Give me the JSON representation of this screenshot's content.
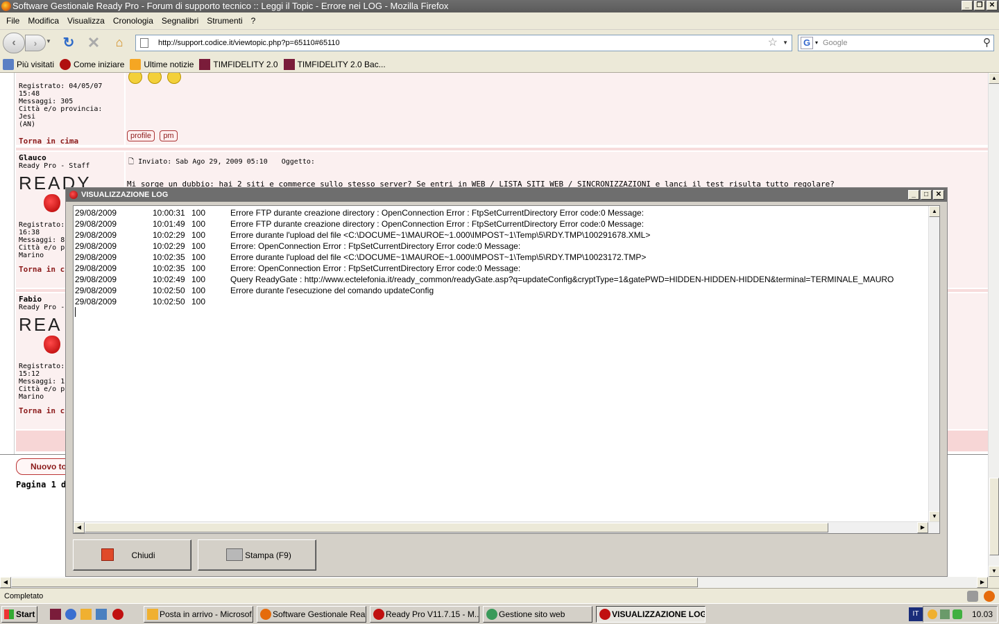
{
  "browser": {
    "title": "Software Gestionale Ready Pro - Forum di supporto tecnico :: Leggi il Topic - Errore nei LOG - Mozilla Firefox",
    "menu": [
      "File",
      "Modifica",
      "Visualizza",
      "Cronologia",
      "Segnalibri",
      "Strumenti",
      "?"
    ],
    "url": "http://support.codice.it/viewtopic.php?p=65110#65110",
    "search_placeholder": "Google",
    "bookmarks": [
      "Più visitati",
      "Come iniziare",
      "Ultime notizie",
      "TIMFIDELITY 2.0",
      "TIMFIDELITY 2.0 Bac..."
    ],
    "status": "Completato"
  },
  "forum": {
    "post1": {
      "registrato": "Registrato: 04/05/07",
      "time": "15:48",
      "messaggi": "Messaggi: 305",
      "citta": "Città e/o provincia: Jesi",
      "citta2": "(AN)",
      "torna": "Torna in cima",
      "btn_profile": "profile",
      "btn_pm": "pm"
    },
    "post2": {
      "name": "Glauco",
      "role": "Ready Pro - Staff",
      "logo": "READY",
      "inviato": "Inviato: Sab Ago 29, 2009 05:10",
      "oggetto": "Oggetto:",
      "body": "Mi sorge un dubbio: hai 2 siti e commerce sullo stesso server? Se entri in WEB / LISTA SITI WEB / SINCRONIZZAZIONI e lanci il test risulta tutto regolare?",
      "registrato": "Registrato: ",
      "time": "16:38",
      "messaggi": "Messaggi: 8",
      "citta": "Città e/o p",
      "citta2": "Marino",
      "torna": "Torna in ci"
    },
    "post3": {
      "name": "Fabio",
      "role": "Ready Pro -",
      "logo": "REA",
      "registrato": "Registrato: ",
      "time": "15:12",
      "messaggi": "Messaggi: 1",
      "citta": "Città e/o p",
      "citta2": "Marino",
      "torna": "Torna in ci"
    },
    "nuovo": "Nuovo to",
    "pagina": "Pagina 1 di"
  },
  "log_window": {
    "title": "VISUALIZZAZIONE LOG",
    "rows": [
      {
        "date": "29/08/2009",
        "time": "10:00:31",
        "code": "100",
        "msg": "Errore FTP durante creazione directory : OpenConnection Error : FtpSetCurrentDirectory Error code:0 Message:"
      },
      {
        "date": "29/08/2009",
        "time": "10:01:49",
        "code": "100",
        "msg": "Errore FTP durante creazione directory : OpenConnection Error : FtpSetCurrentDirectory Error code:0 Message:"
      },
      {
        "date": "29/08/2009",
        "time": "10:02:29",
        "code": "100",
        "msg": "Errore durante l'upload del file <C:\\DOCUME~1\\MAUROE~1.000\\IMPOST~1\\Temp\\5\\RDY.TMP\\100291678.XML>"
      },
      {
        "date": "29/08/2009",
        "time": "10:02:29",
        "code": "100",
        "msg": "Errore: OpenConnection Error : FtpSetCurrentDirectory Error code:0 Message:"
      },
      {
        "date": "29/08/2009",
        "time": "10:02:35",
        "code": "100",
        "msg": "Errore durante l'upload del file <C:\\DOCUME~1\\MAUROE~1.000\\IMPOST~1\\Temp\\5\\RDY.TMP\\10023172.TMP>"
      },
      {
        "date": "29/08/2009",
        "time": "10:02:35",
        "code": "100",
        "msg": "Errore: OpenConnection Error : FtpSetCurrentDirectory Error code:0 Message:"
      },
      {
        "date": "29/08/2009",
        "time": "10:02:49",
        "code": "100",
        "msg": "Query ReadyGate : http://www.ectelefonia.it/ready_common/readyGate.asp?q=updateConfig&cryptType=1&gatePWD=HIDDEN-HIDDEN-HIDDEN&terminal=TERMINALE_MAURO"
      },
      {
        "date": "29/08/2009",
        "time": "10:02:50",
        "code": "100",
        "msg": "Errore durante l'esecuzione del comando updateConfig"
      },
      {
        "date": "29/08/2009",
        "time": "10:02:50",
        "code": "100",
        "msg": ""
      }
    ],
    "btn_close": "Chiudi",
    "btn_print": "Stampa (F9)"
  },
  "taskbar": {
    "start": "Start",
    "tasks": [
      "Posta in arrivo - Microsof...",
      "Software Gestionale Rea...",
      "Ready Pro V11.7.15 - M...",
      "Gestione sito web",
      "VISUALIZZAZIONE LOG"
    ],
    "lang": "IT",
    "clock": "10.03"
  }
}
